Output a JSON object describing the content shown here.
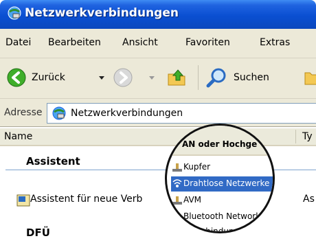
{
  "window": {
    "title": "Netzwerkverbindungen"
  },
  "menu": {
    "items": [
      "Datei",
      "Bearbeiten",
      "Ansicht",
      "Favoriten",
      "Extras"
    ]
  },
  "toolbar": {
    "back_label": "Zurück",
    "search_label": "Suchen"
  },
  "address": {
    "label": "Adresse",
    "value": "Netzwerkverbindungen"
  },
  "list": {
    "columns": [
      "Name",
      "Ty"
    ],
    "groups": [
      {
        "title": "Assistent",
        "items": [
          {
            "label": "Assistent für neue Verb",
            "type": "As"
          }
        ]
      },
      {
        "title": "DFÜ",
        "items": []
      }
    ]
  },
  "magnifier": {
    "header_text": "AN oder Hochge",
    "dropdown_items": [
      {
        "label": "Kupfer",
        "icon": "wired-network-icon",
        "selected": false
      },
      {
        "label": "Drahtlose Netzwerke",
        "icon": "wireless-network-icon",
        "selected": true
      },
      {
        "label": "AVM",
        "icon": "wired-network-icon",
        "selected": false
      },
      {
        "label": "Bluetooth Network",
        "icon": "bluetooth-network-icon",
        "selected": false
      },
      {
        "label": "N-Verbindun",
        "icon": "wired-network-icon",
        "selected": false
      }
    ]
  },
  "colors": {
    "titlebar": "#0a4fd2",
    "selection": "#316ac5",
    "group_line": "#7da2ce"
  }
}
